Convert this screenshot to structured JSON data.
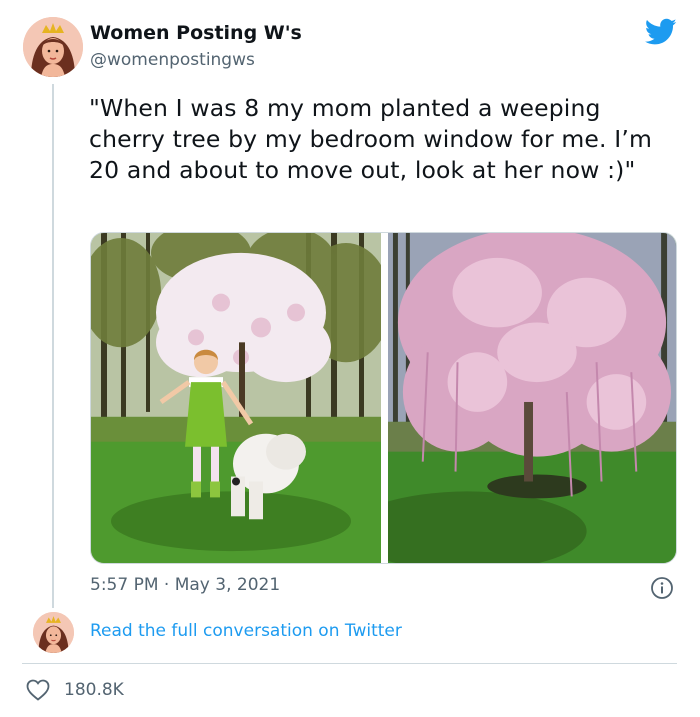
{
  "author": {
    "display_name": "Women Posting W's",
    "handle": "@womenpostingws",
    "avatar_icon": "cartoon-woman-crown-avatar"
  },
  "tweet": {
    "text": "\"When I was 8 my mom planted a weeping cherry tree by my bedroom window for me. I’m 20 and about to move out, look at her now :)\"",
    "timestamp": "5:57 PM · May 3, 2021"
  },
  "media": [
    {
      "icon": "photo-girl-dog-small-tree"
    },
    {
      "icon": "photo-large-weeping-cherry-tree"
    }
  ],
  "footer": {
    "read_link": "Read the full conversation on Twitter",
    "likes": "180.8K"
  },
  "colors": {
    "link": "#1d9bf0",
    "secondary_text": "#536471",
    "divider": "#cfd9de",
    "brand": "#1d9bf0"
  },
  "icons": {
    "brand": "twitter-bird-icon",
    "info": "info-icon",
    "like": "heart-icon"
  }
}
